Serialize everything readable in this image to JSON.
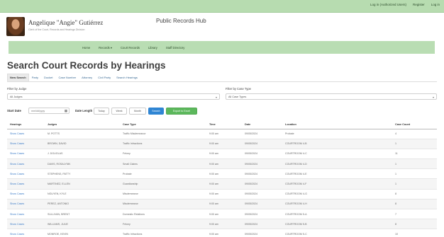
{
  "topbar": {
    "links": [
      "Log in (Authorized Users)",
      "Register",
      "Log in"
    ]
  },
  "header": {
    "name": "Angelique \"Angie\" Gutiérrez",
    "subtitle": "Clerk of the Court, Records and Hearings Division",
    "hub_title": "Public Records Hub"
  },
  "nav": {
    "items": [
      "Home",
      "Records ▾",
      "Court Records",
      "Library",
      "Staff Directory"
    ]
  },
  "page": {
    "title": "Search Court Records by Hearings"
  },
  "tabs": [
    "New Search",
    "Party",
    "Docket",
    "Case Number",
    "Attorney",
    "Civil Party",
    "Search Hearings"
  ],
  "filters": {
    "judge_label": "Filter by Judge",
    "judge_value": "All Judges",
    "casetype_label": "Filter by Case Type",
    "casetype_value": "All Case Types"
  },
  "controls": {
    "start_date_label": "Start Date",
    "start_date_value": "mm/dd/yyyy",
    "date_length_label": "Date Length",
    "today_label": "Today",
    "week_label": "Week",
    "month_label": "Month",
    "search_label": "Search",
    "export_label": "Export to Excel"
  },
  "table": {
    "headers": [
      "Hearings",
      "Judges",
      "Case Type",
      "Time",
      "Date",
      "Location",
      "Case Count"
    ],
    "rows": [
      [
        "Show Cases",
        "M. POTTS",
        "Traffic Misdemeanor",
        "9:00 am",
        "09/05/2024",
        "Probate",
        "4"
      ],
      [
        "Show Cases",
        "BROWN, DAVID",
        "Traffic Infractions",
        "9:00 am",
        "09/05/2024",
        "COURTROOM 4-B",
        "1"
      ],
      [
        "Show Cases",
        "J. DOUGLAS",
        "Felony",
        "9:00 am",
        "09/05/2024",
        "COURTROOM 4-C",
        "11"
      ],
      [
        "Show Cases",
        "DAVIS, ROSALYNN",
        "Small Claims",
        "9:00 am",
        "09/05/2024",
        "COURTROOM 4-D",
        "1"
      ],
      [
        "Show Cases",
        "STEPHENS, PATTY",
        "Probate",
        "9:00 am",
        "09/05/2024",
        "COURTROOM 4-E",
        "1"
      ],
      [
        "Show Cases",
        "MARTINEZ, ELLEN",
        "Guardianship",
        "9:00 am",
        "09/05/2024",
        "COURTROOM 4-F",
        "1"
      ],
      [
        "Show Cases",
        "NGUYEN, KYLE",
        "Misdemeanor",
        "9:00 am",
        "09/05/2024",
        "COURTROOM 4-G",
        "8"
      ],
      [
        "Show Cases",
        "PEREZ, ANTONIO",
        "Misdemeanor",
        "9:00 am",
        "09/05/2024",
        "COURTROOM 4-H",
        "8"
      ],
      [
        "Show Cases",
        "SULLIVAN, BRENT",
        "Domestic Relations",
        "9:00 am",
        "09/05/2024",
        "COURTROOM 5-A",
        "7"
      ],
      [
        "Show Cases",
        "WILLIAMS, JULIE",
        "Felony",
        "9:00 am",
        "09/05/2024",
        "COURTROOM 5-B",
        "8"
      ],
      [
        "Show Cases",
        "MONROE, KEVIN",
        "Traffic Infractions",
        "9:00 am",
        "09/05/2024",
        "COURTROOM 5-C",
        "10"
      ]
    ]
  }
}
